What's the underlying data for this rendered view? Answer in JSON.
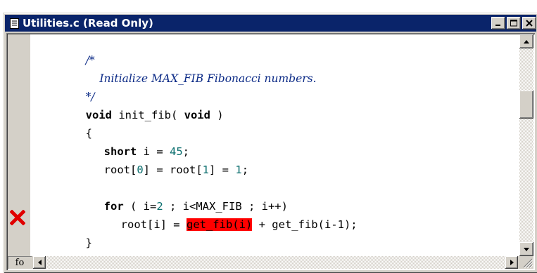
{
  "window": {
    "title": "Utilities.c (Read Only)",
    "doc_icon": "document-icon",
    "minimize_icon": "minimize-icon",
    "maximize_icon": "maximize-icon",
    "close_icon": "close-icon"
  },
  "editor": {
    "lines": {
      "l1": "/*",
      "l2": "    Initialize MAX_FIB Fibonacci numbers.",
      "l3": "*/",
      "l4_kw1": "void",
      "l4_mid": " init_fib( ",
      "l4_kw2": "void",
      "l4_end": " )",
      "l5": "{",
      "l6_kw": "short",
      "l6_mid": " i = ",
      "l6_num": "45",
      "l6_end": ";",
      "l7_a": "root[",
      "l7_n0": "0",
      "l7_b": "] = root[",
      "l7_n1": "1",
      "l7_c": "] = ",
      "l7_n2": "1",
      "l7_d": ";",
      "l8": "",
      "l9_kw": "for",
      "l9_a": " ( i=",
      "l9_num": "2",
      "l9_b": " ; i<MAX_FIB ; i++)",
      "l10_a": "root[i] = ",
      "l10_hl": "get_fib(i)",
      "l10_b": " + get_fib(i-1);",
      "l11": "}"
    },
    "breakpoint_icon": "error-x-icon"
  },
  "statusbar": {
    "function_box": "fo",
    "left_arrow_icon": "scroll-left-icon",
    "right_arrow_icon": "scroll-right-icon"
  },
  "colors": {
    "titlebar": "#0a246a",
    "comment": "#0b2a86",
    "number": "#0a6e6e",
    "highlight": "#ff0000"
  }
}
